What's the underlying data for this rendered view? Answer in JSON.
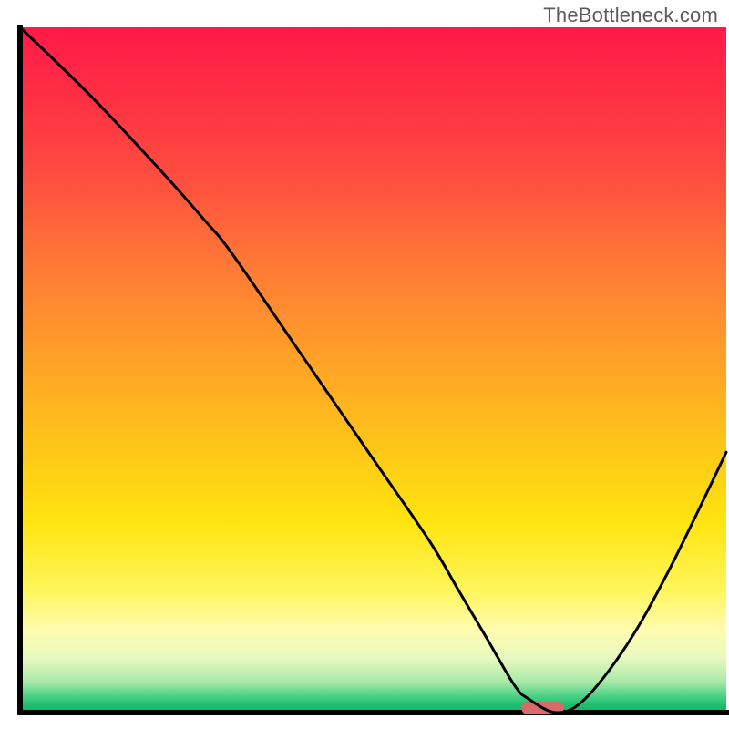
{
  "watermark": "TheBottleneck.com",
  "chart_data": {
    "type": "line",
    "title": "",
    "xlabel": "",
    "ylabel": "",
    "xlim": [
      0,
      100
    ],
    "ylim": [
      0,
      100
    ],
    "series": [
      {
        "name": "bottleneck-curve",
        "x": [
          0,
          10,
          20,
          26,
          30,
          40,
          50,
          58,
          62,
          66,
          70,
          72,
          76,
          80,
          86,
          92,
          100
        ],
        "y": [
          100,
          90,
          79,
          72,
          67,
          52,
          37,
          25,
          18,
          11,
          4,
          2,
          0,
          2,
          10,
          21,
          38
        ]
      }
    ],
    "marker": {
      "x_center": 74,
      "width": 6,
      "y": 0,
      "color": "#d86a6a"
    },
    "gradient_stops": [
      {
        "offset": 0.0,
        "color": "#ff1a47"
      },
      {
        "offset": 0.1,
        "color": "#ff2f44"
      },
      {
        "offset": 0.22,
        "color": "#ff4e3f"
      },
      {
        "offset": 0.35,
        "color": "#ff7a36"
      },
      {
        "offset": 0.48,
        "color": "#ffa028"
      },
      {
        "offset": 0.6,
        "color": "#ffc21a"
      },
      {
        "offset": 0.72,
        "color": "#ffe40f"
      },
      {
        "offset": 0.82,
        "color": "#fff55a"
      },
      {
        "offset": 0.88,
        "color": "#fffcb0"
      },
      {
        "offset": 0.92,
        "color": "#e8f9c0"
      },
      {
        "offset": 0.955,
        "color": "#a8e9a8"
      },
      {
        "offset": 0.975,
        "color": "#4fd387"
      },
      {
        "offset": 0.99,
        "color": "#1abd6f"
      },
      {
        "offset": 1.0,
        "color": "#17b566"
      }
    ],
    "axes_color": "#000000"
  }
}
